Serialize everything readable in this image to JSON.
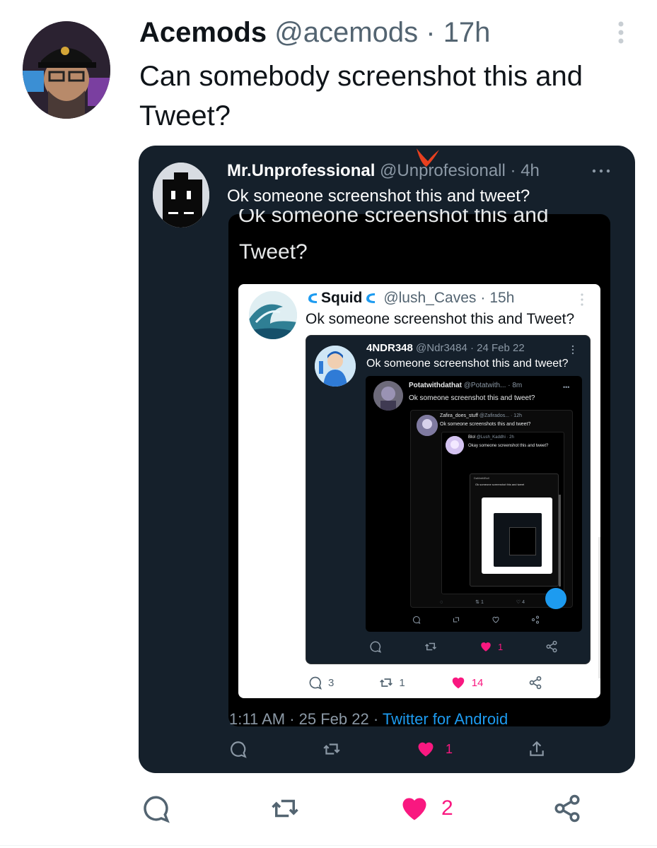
{
  "outer": {
    "name": "Acemods",
    "handle": "@acemods",
    "sep": "·",
    "time": "17h",
    "text": "Can somebody screenshot this and Tweet?",
    "likes": "2"
  },
  "shot": {
    "name": "Mr.Unprofessional",
    "handle": "@Unprofesionall",
    "time": "4h",
    "text": "Ok someone screenshot this and tweet?",
    "media_text_top": "Ok someone screenshot this and",
    "media_text2": "Tweet?",
    "meta_time": "1:11 AM · 25 Feb 22 · ",
    "meta_source": "Twitter for Android",
    "likes": "1"
  },
  "squid": {
    "name": "Squid",
    "handle": "@lush_Caves",
    "time": "15h",
    "text": "Ok someone screenshot this and Tweet?",
    "replies": "3",
    "retweets": "1",
    "likes": "14"
  },
  "ndr": {
    "name": "4NDR348",
    "handle": "@Ndr3484",
    "time": "24 Feb 22",
    "text": "Ok someone screenshot this and tweet?",
    "likes": "1"
  },
  "potat": {
    "name": "Potatwithdathat",
    "handle": "@Potatwith...",
    "time": "8m",
    "text": "Ok someone screenshot this and tweet?"
  },
  "zafira": {
    "name": "Zafira_does_stuff",
    "handle": "@Zafirados...",
    "time": "12h",
    "text": "Ok someone screenshots this and tweet?",
    "retweets": "1",
    "likes": "4"
  },
  "blol": {
    "name": "Blol",
    "handle": "@Lush_Kaddhi",
    "time": "2h",
    "text": "Okay someone screenshot this and tweet?",
    "text2": "Ok someone screenshot this and tweet?"
  },
  "deep": {
    "name": "DaMatt4Boll",
    "text": "Ok someone screenshot this and tweet"
  },
  "colors": {
    "dark_bg": "#15202b",
    "accent": "#1d9bf0",
    "like": "#f91880",
    "muted": "#536471"
  }
}
